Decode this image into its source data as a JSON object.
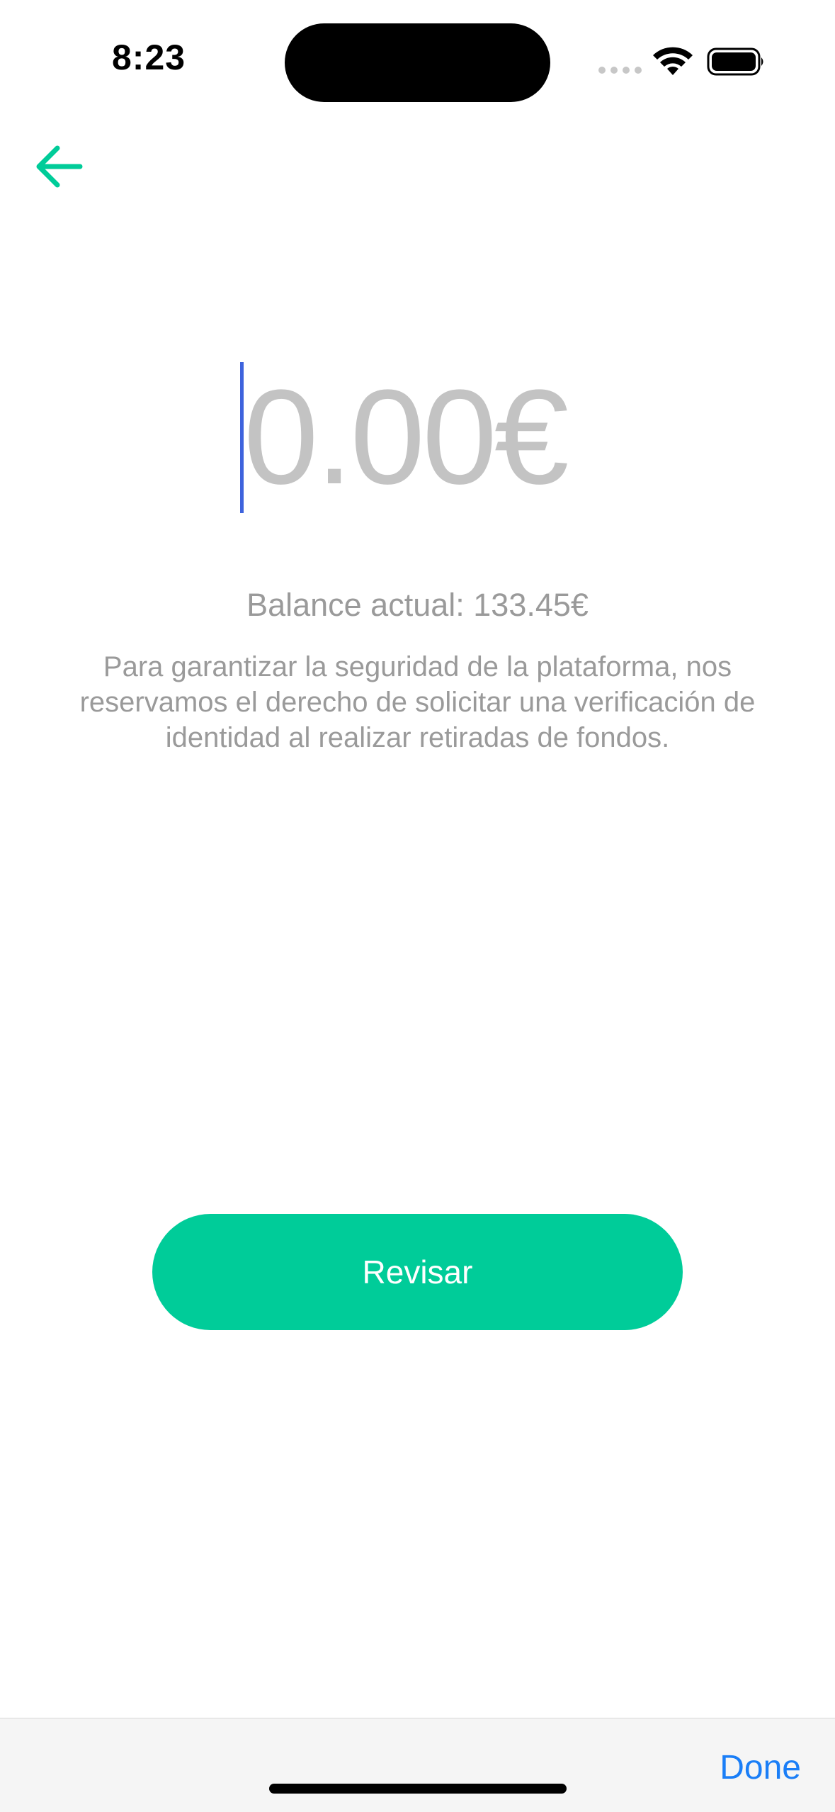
{
  "status_bar": {
    "time": "8:23",
    "icons": [
      "cellular-icon",
      "wifi-icon",
      "battery-icon"
    ]
  },
  "nav": {
    "back_icon": "arrow-left-icon",
    "accent_color": "#00cc99"
  },
  "amount": {
    "placeholder": "0.00€",
    "caret_color": "#3e63dd"
  },
  "balance_text": "Balance actual: 133.45€",
  "info_text": "Para garantizar la seguridad de la plataforma, nos reservamos el derecho de solicitar una verificación de identidad al realizar retiradas de fondos.",
  "review_button_label": "Revisar",
  "keyboard_toolbar": {
    "done_label": "Done"
  }
}
